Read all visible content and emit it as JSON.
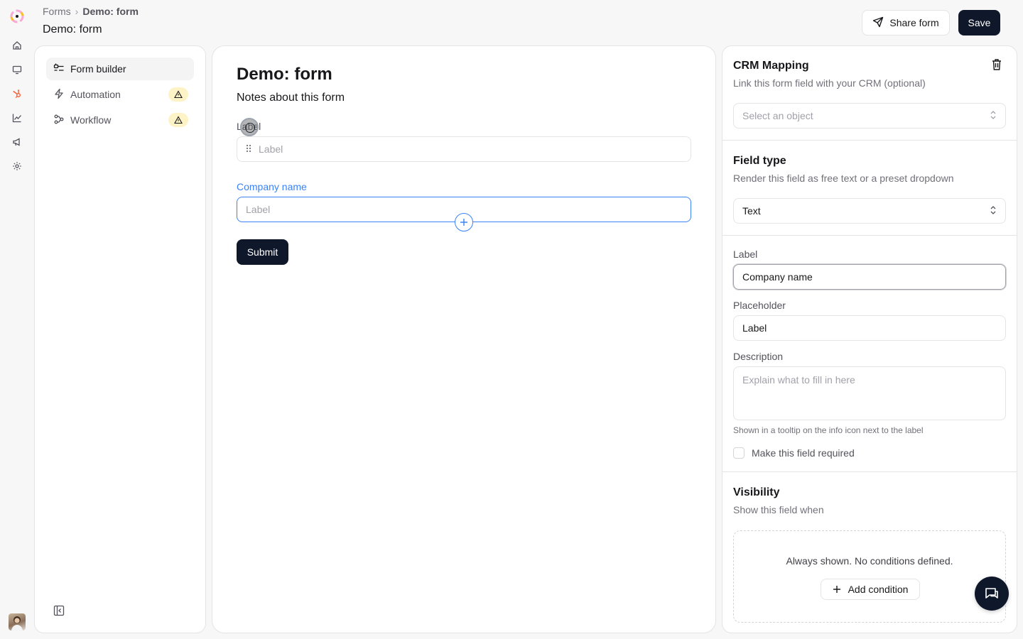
{
  "breadcrumb": {
    "parent": "Forms",
    "separator": "›",
    "current": "Demo: form"
  },
  "header": {
    "title": "Demo: form",
    "share_label": "Share form",
    "save_label": "Save"
  },
  "rail": {
    "icons": [
      "app-logo",
      "home-icon",
      "monitor-icon",
      "hubspot-icon",
      "chart-icon",
      "megaphone-icon",
      "settings-icon"
    ]
  },
  "left_nav": {
    "items": [
      {
        "label": "Form builder",
        "icon": "form-builder-icon",
        "active": true,
        "warning": false
      },
      {
        "label": "Automation",
        "icon": "lightning-icon",
        "active": false,
        "warning": true
      },
      {
        "label": "Workflow",
        "icon": "workflow-icon",
        "active": false,
        "warning": true
      }
    ]
  },
  "form": {
    "title": "Demo: form",
    "notes": "Notes about this form",
    "fields": [
      {
        "label": "Label",
        "placeholder": "Label"
      },
      {
        "label": "Company name",
        "placeholder": "Label"
      }
    ],
    "submit_label": "Submit"
  },
  "settings": {
    "crm": {
      "title": "CRM Mapping",
      "subtitle": "Link this form field with your CRM (optional)",
      "select_placeholder": "Select an object"
    },
    "field_type": {
      "title": "Field type",
      "subtitle": "Render this field as free text or a preset dropdown",
      "value": "Text"
    },
    "label": {
      "label": "Label",
      "value": "Company name"
    },
    "placeholder": {
      "label": "Placeholder",
      "value": "Label"
    },
    "description": {
      "label": "Description",
      "placeholder": "Explain what to fill in here",
      "hint": "Shown in a tooltip on the info icon next to the label"
    },
    "required_label": "Make this field required",
    "visibility": {
      "title": "Visibility",
      "subtitle": "Show this field when",
      "empty_message": "Always shown. No conditions defined.",
      "add_condition_label": "Add condition"
    }
  },
  "colors": {
    "primary": "#0f172a",
    "accent": "#3b82f6",
    "warning_bg": "#fef3c7",
    "hubspot": "#ff5c35"
  }
}
